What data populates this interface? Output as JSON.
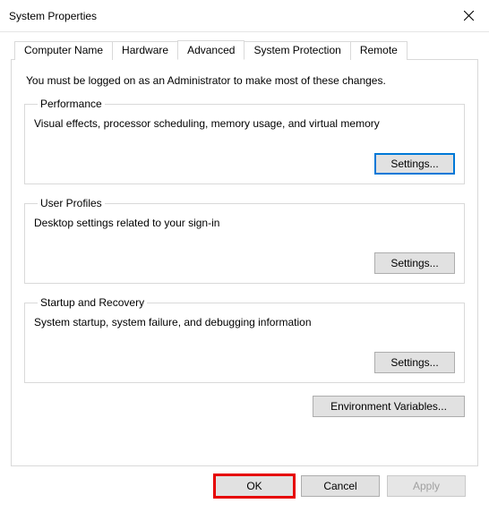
{
  "window": {
    "title": "System Properties"
  },
  "tabs": {
    "computer_name": "Computer Name",
    "hardware": "Hardware",
    "advanced": "Advanced",
    "system_protection": "System Protection",
    "remote": "Remote"
  },
  "content": {
    "intro": "You must be logged on as an Administrator to make most of these changes.",
    "performance": {
      "legend": "Performance",
      "desc": "Visual effects, processor scheduling, memory usage, and virtual memory",
      "button": "Settings..."
    },
    "user_profiles": {
      "legend": "User Profiles",
      "desc": "Desktop settings related to your sign-in",
      "button": "Settings..."
    },
    "startup_recovery": {
      "legend": "Startup and Recovery",
      "desc": "System startup, system failure, and debugging information",
      "button": "Settings..."
    },
    "env_button": "Environment Variables..."
  },
  "footer": {
    "ok": "OK",
    "cancel": "Cancel",
    "apply": "Apply"
  }
}
